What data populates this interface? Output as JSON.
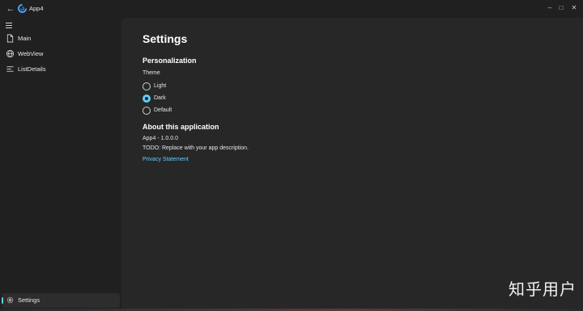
{
  "app": {
    "title": "App4"
  },
  "nav": {
    "items": [
      {
        "label": "Main",
        "icon": "document-icon"
      },
      {
        "label": "WebView",
        "icon": "globe-icon"
      },
      {
        "label": "ListDetails",
        "icon": "list-icon"
      }
    ],
    "footer": {
      "label": "Settings",
      "icon": "gear-icon"
    }
  },
  "settings": {
    "title": "Settings",
    "personalization": {
      "heading": "Personalization",
      "theme_label": "Theme",
      "options": [
        {
          "label": "Light",
          "selected": false
        },
        {
          "label": "Dark",
          "selected": true
        },
        {
          "label": "Default",
          "selected": false
        }
      ]
    },
    "about": {
      "heading": "About this application",
      "version": "App4 - 1.0.0.0",
      "description": "TODO: Replace with your app description.",
      "privacy_link": "Privacy Statement"
    }
  },
  "watermark": "知乎用户",
  "colors": {
    "accent": "#60cdff",
    "nav_bg": "#202020",
    "content_bg": "#272727"
  }
}
